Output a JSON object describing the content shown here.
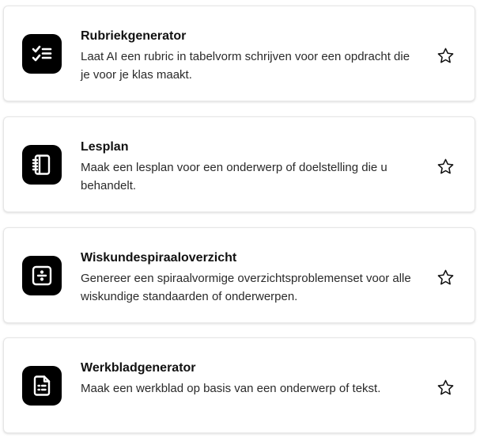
{
  "tools": [
    {
      "title": "Rubriekgenerator",
      "description": "Laat AI een rubric in tabelvorm schrijven voor een opdracht die je voor je klas maakt.",
      "icon": "checklist-icon"
    },
    {
      "title": "Lesplan",
      "description": "Maak een lesplan voor een onderwerp of doelstelling die u behandelt.",
      "icon": "notebook-icon"
    },
    {
      "title": "Wiskundespiraaloverzicht",
      "description": "Genereer een spiraalvormige overzichtsproblemenset voor alle wiskundige standaarden of onderwerpen.",
      "icon": "divide-icon"
    },
    {
      "title": "Werkbladgenerator",
      "description": "Maak een werkblad op basis van een onderwerp of tekst.",
      "icon": "document-icon"
    }
  ],
  "colors": {
    "icon_background": "#000000",
    "icon_foreground": "#ffffff",
    "card_border": "#e6e6e6"
  }
}
